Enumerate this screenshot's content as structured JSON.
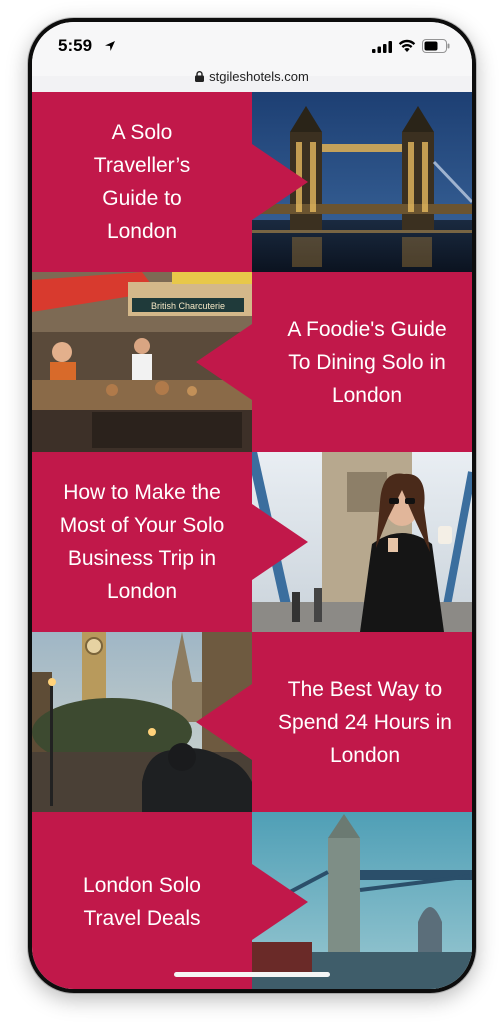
{
  "status_bar": {
    "time": "5:59"
  },
  "browser": {
    "url": "stgileshotels.com"
  },
  "articles": [
    {
      "title": "A Solo Traveller’s Guide to London"
    },
    {
      "title": "A Foodie's Guide To Dining Solo in London"
    },
    {
      "title": "How to Make the Most of Your Solo Business Trip in London"
    },
    {
      "title": "The Best Way to Spend 24 Hours in London"
    },
    {
      "title": "London Solo Travel Deals"
    }
  ],
  "photo_text": {
    "stall_sign": "British Charcuterie"
  },
  "colors": {
    "accent": "#c1184a"
  }
}
